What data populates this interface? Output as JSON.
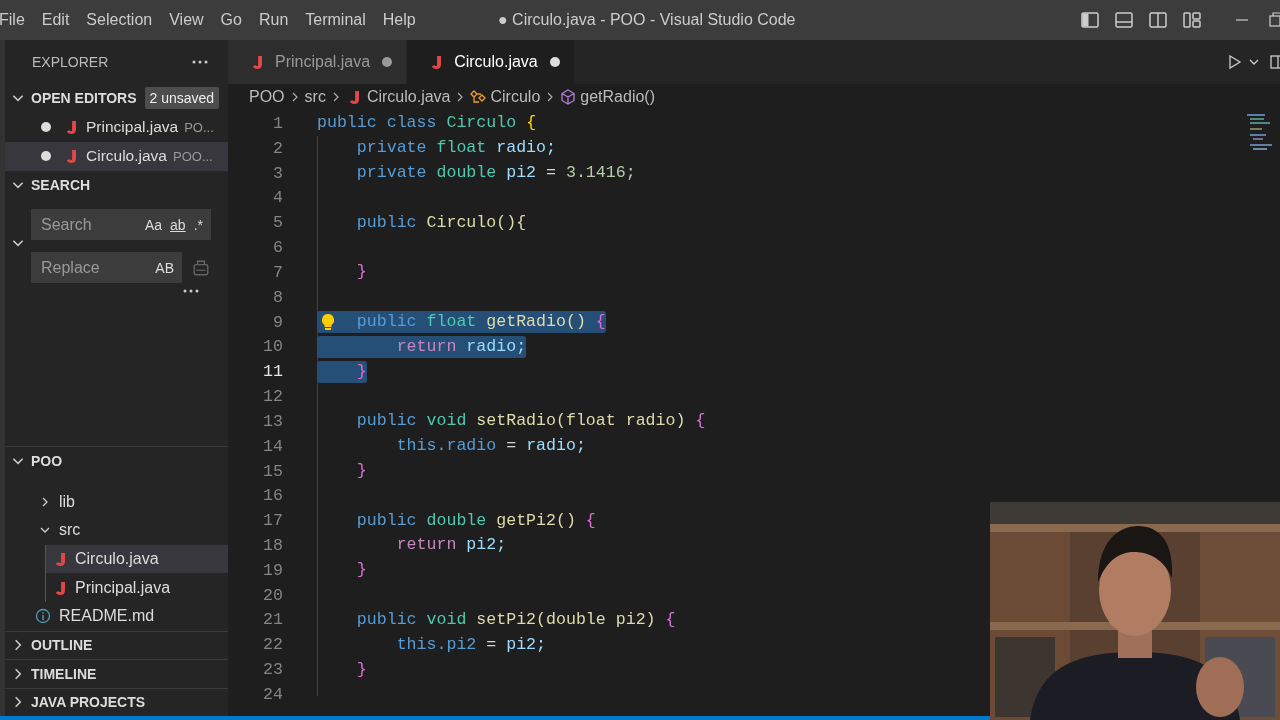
{
  "menu": [
    "File",
    "Edit",
    "Selection",
    "View",
    "Go",
    "Run",
    "Terminal",
    "Help"
  ],
  "window_title": "● Circulo.java - POO - Visual Studio Code",
  "explorer": {
    "title": "EXPLORER"
  },
  "open_editors": {
    "title": "OPEN EDITORS",
    "expanded": true,
    "badge": "2 unsaved",
    "items": [
      {
        "name": "Principal.java",
        "path": "PO...",
        "modified": true,
        "selected": false
      },
      {
        "name": "Circulo.java",
        "path": "POO...",
        "modified": true,
        "selected": true
      }
    ]
  },
  "search": {
    "title": "SEARCH",
    "expanded": true,
    "search_placeholder": "Search",
    "replace_placeholder": "Replace",
    "search_options": [
      "Aa",
      "ab",
      ".*"
    ],
    "replace_option": "AB"
  },
  "project": {
    "title": "POO",
    "expanded": true,
    "children": [
      {
        "name": "lib",
        "kind": "folder",
        "expanded": false,
        "selected": false
      },
      {
        "name": "src",
        "kind": "folder",
        "expanded": true,
        "selected": false,
        "children": [
          {
            "name": "Circulo.java",
            "kind": "java",
            "selected": true
          },
          {
            "name": "Principal.java",
            "kind": "java",
            "selected": false
          }
        ]
      },
      {
        "name": "README.md",
        "kind": "info",
        "selected": false
      }
    ]
  },
  "panels": [
    {
      "title": "OUTLINE",
      "expanded": false
    },
    {
      "title": "TIMELINE",
      "expanded": false
    },
    {
      "title": "JAVA PROJECTS",
      "expanded": false
    }
  ],
  "tabs": [
    {
      "label": "Principal.java",
      "selected": false,
      "modified": true
    },
    {
      "label": "Circulo.java",
      "selected": true,
      "modified": true
    }
  ],
  "breadcrumb": [
    {
      "label": "POO",
      "kind": "folder"
    },
    {
      "label": "src",
      "kind": "folder"
    },
    {
      "label": "Circulo.java",
      "kind": "java"
    },
    {
      "label": "Circulo",
      "kind": "class"
    },
    {
      "label": "getRadio()",
      "kind": "method"
    }
  ],
  "lines": [
    {
      "n": "1",
      "kind": "top",
      "selected": false,
      "current": false,
      "bulb": false,
      "tokens": [
        {
          "kind": "kw",
          "text": "public"
        },
        {
          "kind": "kw",
          "text": "class"
        },
        {
          "kind": "cls",
          "text": "Circulo"
        },
        {
          "kind": "b1",
          "text": "{"
        }
      ]
    },
    {
      "n": "2",
      "kind": "member",
      "selected": false,
      "current": false,
      "bulb": false,
      "tokens": [
        {
          "kind": "kw",
          "text": "private"
        },
        {
          "kind": "type",
          "text": "float"
        },
        {
          "kind": "var",
          "text": "radio;"
        }
      ]
    },
    {
      "n": "3",
      "kind": "member",
      "selected": false,
      "current": false,
      "bulb": false,
      "tokens": [
        {
          "kind": "kw",
          "text": "private"
        },
        {
          "kind": "type",
          "text": "double"
        },
        {
          "kind": "var",
          "text": "pi2"
        },
        {
          "kind": "p",
          "text": "="
        },
        {
          "kind": "num",
          "text": "3.1416;"
        }
      ]
    },
    {
      "n": "4",
      "current": false,
      "bulb": false
    },
    {
      "n": "5",
      "kind": "member",
      "selected": false,
      "current": false,
      "bulb": false,
      "tokens": [
        {
          "kind": "kw",
          "text": "public"
        },
        {
          "kind": "fn",
          "text": "Circulo(){"
        }
      ]
    },
    {
      "n": "6",
      "current": false,
      "bulb": false
    },
    {
      "n": "7",
      "kind": "member",
      "selected": false,
      "current": false,
      "bulb": false,
      "tokens": [
        {
          "kind": "b2",
          "text": "}"
        }
      ]
    },
    {
      "n": "8",
      "current": false,
      "bulb": false
    },
    {
      "n": "9",
      "kind": "member",
      "selected": true,
      "current": false,
      "bulb": true,
      "tokens": [
        {
          "kind": "kw",
          "text": "public"
        },
        {
          "kind": "type",
          "text": "float"
        },
        {
          "kind": "fn",
          "text": "getRadio()"
        },
        {
          "kind": "b2",
          "text": "{"
        }
      ]
    },
    {
      "n": "10",
      "kind": "body",
      "selected": true,
      "current": false,
      "bulb": false,
      "tokens": [
        {
          "kind": "ctl",
          "text": "return"
        },
        {
          "kind": "var",
          "text": "radio;"
        }
      ]
    },
    {
      "n": "11",
      "kind": "member",
      "selected": true,
      "current": true,
      "bulb": false,
      "tokens": [
        {
          "kind": "b2",
          "text": "}"
        }
      ]
    },
    {
      "n": "12",
      "current": false,
      "bulb": false
    },
    {
      "n": "13",
      "kind": "member",
      "selected": false,
      "current": false,
      "bulb": false,
      "tokens": [
        {
          "kind": "kw",
          "text": "public"
        },
        {
          "kind": "type",
          "text": "void"
        },
        {
          "kind": "fn",
          "text": "setRadio(float radio)"
        },
        {
          "kind": "b2",
          "text": "{"
        }
      ]
    },
    {
      "n": "14",
      "kind": "body",
      "selected": false,
      "current": false,
      "bulb": false,
      "tokens": [
        {
          "kind": "kw",
          "text": "this.radio"
        },
        {
          "kind": "p",
          "text": "="
        },
        {
          "kind": "var",
          "text": "radio;"
        }
      ]
    },
    {
      "n": "15",
      "kind": "member",
      "selected": false,
      "current": false,
      "bulb": false,
      "tokens": [
        {
          "kind": "b2",
          "text": "}"
        }
      ]
    },
    {
      "n": "16",
      "current": false,
      "bulb": false
    },
    {
      "n": "17",
      "kind": "member",
      "selected": false,
      "current": false,
      "bulb": false,
      "tokens": [
        {
          "kind": "kw",
          "text": "public"
        },
        {
          "kind": "type",
          "text": "double"
        },
        {
          "kind": "fn",
          "text": "getPi2()"
        },
        {
          "kind": "b2",
          "text": "{"
        }
      ]
    },
    {
      "n": "18",
      "kind": "body",
      "selected": false,
      "current": false,
      "bulb": false,
      "tokens": [
        {
          "kind": "ctl",
          "text": "return"
        },
        {
          "kind": "var",
          "text": "pi2;"
        }
      ]
    },
    {
      "n": "19",
      "kind": "member",
      "selected": false,
      "current": false,
      "bulb": false,
      "tokens": [
        {
          "kind": "b2",
          "text": "}"
        }
      ]
    },
    {
      "n": "20",
      "current": false,
      "bulb": false
    },
    {
      "n": "21",
      "kind": "member",
      "selected": false,
      "current": false,
      "bulb": false,
      "tokens": [
        {
          "kind": "kw",
          "text": "public"
        },
        {
          "kind": "type",
          "text": "void"
        },
        {
          "kind": "fn",
          "text": "setPi2(double pi2)"
        },
        {
          "kind": "b2",
          "text": "{"
        }
      ]
    },
    {
      "n": "22",
      "kind": "body",
      "selected": false,
      "current": false,
      "bulb": false,
      "tokens": [
        {
          "kind": "kw",
          "text": "this.pi2"
        },
        {
          "kind": "p",
          "text": "="
        },
        {
          "kind": "var",
          "text": "pi2;"
        }
      ]
    },
    {
      "n": "23",
      "kind": "member",
      "selected": false,
      "current": false,
      "bulb": false,
      "tokens": [
        {
          "kind": "b2",
          "text": "}"
        }
      ]
    },
    {
      "n": "24",
      "current": false,
      "bulb": false
    }
  ]
}
